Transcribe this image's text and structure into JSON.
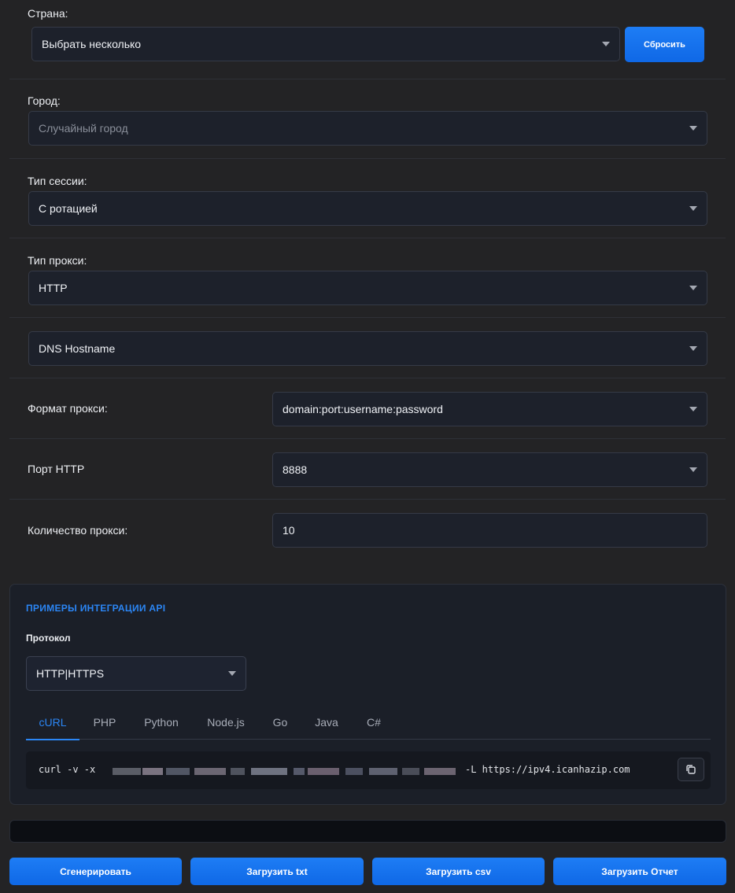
{
  "country": {
    "label": "Страна:",
    "value": "Выбрать несколько",
    "reset_label": "Сбросить"
  },
  "city": {
    "label": "Город:",
    "placeholder": "Случайный город"
  },
  "session_type": {
    "label": "Тип сессии:",
    "value": "С ротацией"
  },
  "proxy_type": {
    "label": "Тип прокси:",
    "value": "HTTP"
  },
  "host_type": {
    "value": "DNS Hostname"
  },
  "proxy_format": {
    "label": "Формат прокси:",
    "value": "domain:port:username:password"
  },
  "http_port": {
    "label": "Порт HTTP",
    "value": "8888"
  },
  "proxy_count": {
    "label": "Количество прокси:",
    "value": "10"
  },
  "api_panel": {
    "title": "ПРИМЕРЫ ИНТЕГРАЦИИ API",
    "protocol_label": "Протокол",
    "protocol_value": "HTTP|HTTPS",
    "tabs": [
      "cURL",
      "PHP",
      "Python",
      "Node.js",
      "Go",
      "Java",
      "C#"
    ],
    "active_tab": "cURL",
    "code_prefix": "curl -v -x",
    "code_suffix": "-L https://ipv4.icanhazip.com"
  },
  "actions": {
    "generate": "Сгенерировать",
    "download_txt": "Загрузить txt",
    "download_csv": "Загрузить csv",
    "download_report": "Загрузить Отчет"
  },
  "icons": [
    "chevron-down-icon",
    "copy-icon"
  ],
  "colors": {
    "accent": "#1a75f0",
    "background": "#232325",
    "field": "#1d212b",
    "panel": "#1b1f28"
  }
}
